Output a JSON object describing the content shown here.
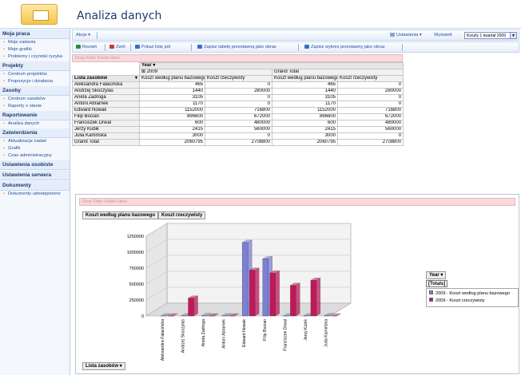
{
  "header": {
    "title": "Analiza danych",
    "logo": "sharepoint-logo-icon"
  },
  "nav": {
    "sections": [
      {
        "title": "Moja praca",
        "items": [
          "Moje zadania",
          "Moje grafiki",
          "Problemy i czynniki ryzyka"
        ]
      },
      {
        "title": "Projekty",
        "items": [
          "Centrum projektów",
          "Propozycje i działania"
        ]
      },
      {
        "title": "Zasoby",
        "items": [
          "Centrum zasobów",
          "Raporty o stanie"
        ]
      },
      {
        "title": "Raportowanie",
        "items": [
          "Analiza danych"
        ]
      },
      {
        "title": "Zatwierdzenia",
        "items": [
          "Aktualizacje zadań",
          "Grafik",
          "Czas administracyjny"
        ]
      },
      {
        "title": "Ustawienia osobiste",
        "items": []
      },
      {
        "title": "Ustawienia serwera",
        "items": []
      },
      {
        "title": "Dokumenty",
        "items": [
          "Dokumenty udostępnione"
        ]
      }
    ]
  },
  "toolbar": {
    "actions_label": "Akcje ▾",
    "expand_label": "Rozwiń",
    "collapse_label": "Zwiń",
    "fieldlist_label": "Pokaż listę pól",
    "save_pivot_label": "Zapisz tabelę przestawną jako obraz",
    "save_chart_label": "Zapisz wykres przestawny jako obraz",
    "settings_label": "Ustawienia ▾",
    "view_label": "Wyświetl:",
    "view_value": "Koszty 1 kwartał 2009"
  },
  "pivot": {
    "drop_filter": "Drop Filter Fields Here",
    "year_label": "Year ▾",
    "year_value": "⊞ 2009",
    "grand_total_label": "Grand Total",
    "row_field": "Lista zasobów",
    "col1": "Koszt według planu bazowego",
    "col2": "Koszt rzeczywisty",
    "rows": [
      {
        "name": "Aleksandra Falacińska",
        "plan": "465",
        "actual": "0"
      },
      {
        "name": "Andrzej Skoczylas",
        "plan": "1440",
        "actual": "280000"
      },
      {
        "name": "Aneta Zadroga",
        "plan": "3105",
        "actual": "0"
      },
      {
        "name": "Antoni Abramek",
        "plan": "1170",
        "actual": "0"
      },
      {
        "name": "Edward Nowak",
        "plan": "1152000",
        "actual": "716800"
      },
      {
        "name": "Filip Bocian",
        "plan": "896600",
        "actual": "672000"
      },
      {
        "name": "Franciszek Drwal",
        "plan": "600",
        "actual": "480000"
      },
      {
        "name": "Jerzy Kubik",
        "plan": "2415",
        "actual": "560000"
      },
      {
        "name": "Julia Kamińska",
        "plan": "3000",
        "actual": "0"
      }
    ],
    "grand_total": {
      "name": "Grand Total",
      "plan": "2060795",
      "actual": "2708800"
    }
  },
  "chart_panel": {
    "drop_filter": "Drop Filter Fields Here",
    "tab1": "Koszt według planu bazowego",
    "tab2": "Koszt rzeczywisty",
    "legend_year": "Year ▾",
    "legend_totals": "[Totals]",
    "row_field": "Lista zasobów ▾"
  },
  "chart_data": {
    "type": "bar",
    "three_d": true,
    "categories": [
      "Aleksandra Falacińska",
      "Andrzej Skoczylas",
      "Aneta Zadroga",
      "Antoni Abramek",
      "Edward Nowak",
      "Filip Bocian",
      "Franciszek Drwal",
      "Jerzy Kubik",
      "Julia Kamińska"
    ],
    "series": [
      {
        "name": "2009 - Koszt według planu bazowego",
        "values": [
          465,
          1440,
          3105,
          1170,
          1152000,
          896600,
          600,
          2415,
          3000
        ],
        "color": "#7b7fd6"
      },
      {
        "name": "2009 - Koszt rzeczywisty",
        "values": [
          0,
          280000,
          0,
          0,
          716800,
          672000,
          480000,
          560000,
          0
        ],
        "color": "#c0185a"
      }
    ],
    "yticks": [
      "1250000",
      "1000000",
      "750000",
      "500000",
      "250000",
      "0"
    ],
    "ylim": [
      0,
      1250000
    ],
    "legend": "right"
  }
}
